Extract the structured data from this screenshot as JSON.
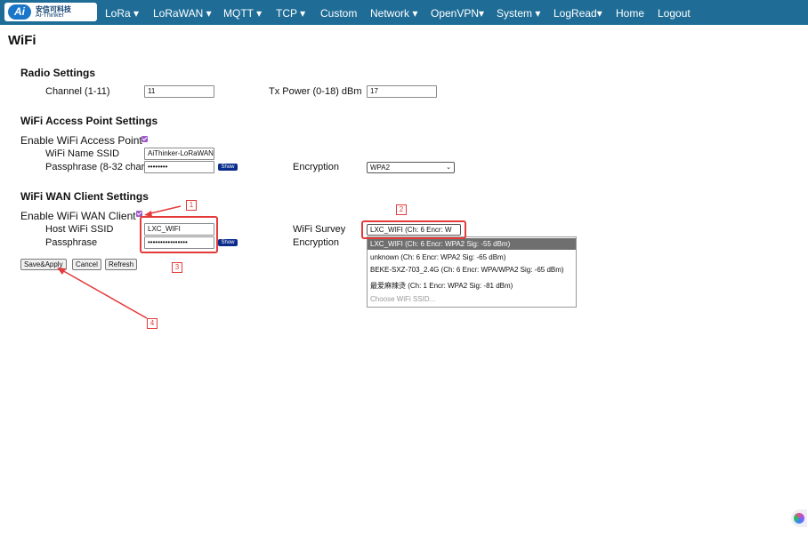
{
  "header": {
    "logo_cn": "安信可科技",
    "logo_en": "Ai-Thinker",
    "logo_badge": "Ai",
    "nav": [
      "LoRa ▾",
      "LoRaWAN ▾",
      "MQTT ▾",
      "TCP ▾",
      "Custom",
      "Network ▾",
      "OpenVPN▾",
      "System ▾",
      "LogRead▾",
      "Home",
      "Logout"
    ]
  },
  "page_title": "WiFi",
  "radio": {
    "heading": "Radio Settings",
    "channel_label": "Channel (1-11)",
    "channel_value": "11",
    "txpower_label": "Tx Power (0-18) dBm",
    "txpower_value": "17"
  },
  "ap": {
    "heading": "WiFi Access Point Settings",
    "enable_label": "Enable WiFi Access Point",
    "ssid_label": "WiFi Name SSID",
    "ssid_value": "AiThinker-LoRaWAN",
    "pass_label": "Passphrase (8-32 char)",
    "pass_value": "••••••••",
    "show_label": "Show",
    "enc_label": "Encryption",
    "enc_value": "WPA2"
  },
  "wan": {
    "heading": "WiFi WAN Client Settings",
    "enable_label": "Enable WiFi WAN Client",
    "host_label": "Host WiFi SSID",
    "host_value": "LXC_WIFI",
    "pass_label": "Passphrase",
    "pass_value": "••••••••••••••••",
    "show_label": "Show",
    "survey_label": "WiFi Survey",
    "survey_value": "LXC_WIFI (Ch: 6 Encr: W",
    "enc_label": "Encryption",
    "survey_options": [
      "LXC_WIFI (Ch: 6 Encr: WPA2 Sig: -55 dBm)",
      "unknown (Ch: 6 Encr: WPA2 Sig: -65 dBm)",
      "BEKE-SXZ-703_2.4G (Ch: 6 Encr: WPA/WPA2 Sig: -65 dBm)",
      "最爱麻辣烫 (Ch: 1 Encr: WPA2 Sig: -81 dBm)",
      "Choose WiFi SSID..."
    ]
  },
  "buttons": {
    "save": "Save&Apply",
    "cancel": "Cancel",
    "refresh": "Refresh"
  },
  "annotations": [
    "1",
    "2",
    "3",
    "4"
  ],
  "colors": {
    "topbar": "#1f6d97",
    "annotation": "#e43a3a",
    "checkbox": "#a05bc9",
    "show_button": "#0a2c8c"
  }
}
